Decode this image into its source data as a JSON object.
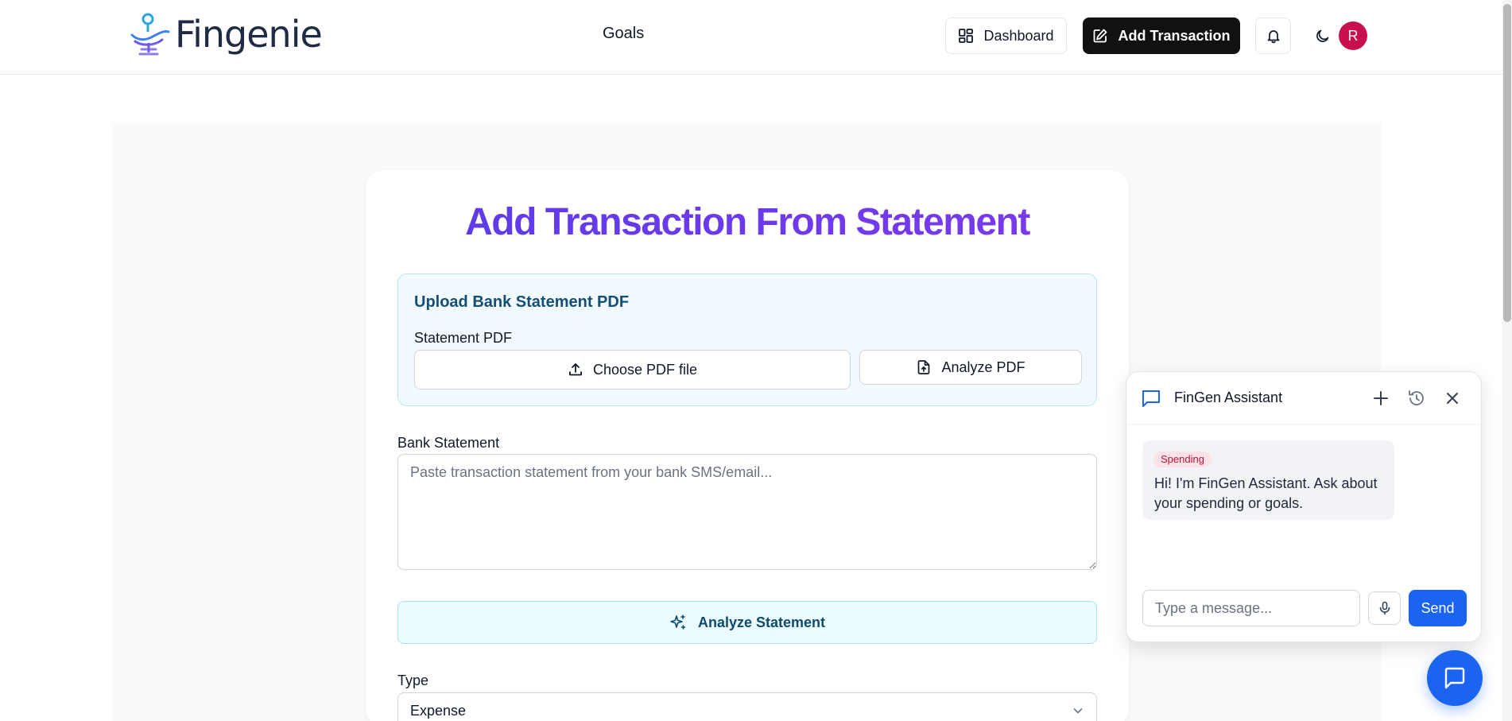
{
  "header": {
    "brand": "Fingenie",
    "nav_goals": "Goals",
    "dashboard_label": "Dashboard",
    "add_transaction_label": "Add Transaction",
    "avatar_initial": "R"
  },
  "main": {
    "title": "Add Transaction From Statement",
    "upload": {
      "title": "Upload Bank Statement PDF",
      "field_label": "Statement PDF",
      "choose_label": "Choose PDF file",
      "analyze_pdf_label": "Analyze PDF"
    },
    "bank_statement": {
      "label": "Bank Statement",
      "value": "",
      "placeholder": "Paste transaction statement from your bank SMS/email..."
    },
    "analyze_statement_label": "Analyze Statement",
    "type": {
      "label": "Type",
      "selected": "Expense"
    }
  },
  "chat": {
    "title": "FinGen Assistant",
    "message_tag": "Spending",
    "message_text": "Hi! I'm FinGen Assistant. Ask about your spending or goals.",
    "input_value": "",
    "input_placeholder": "Type a message...",
    "send_label": "Send"
  },
  "colors": {
    "title_gradient_start": "#5b3bea",
    "title_gradient_end": "#7c3aed",
    "primary_blue": "#1a64f0",
    "avatar_bg": "#c8104c",
    "upload_title": "#164e73"
  }
}
